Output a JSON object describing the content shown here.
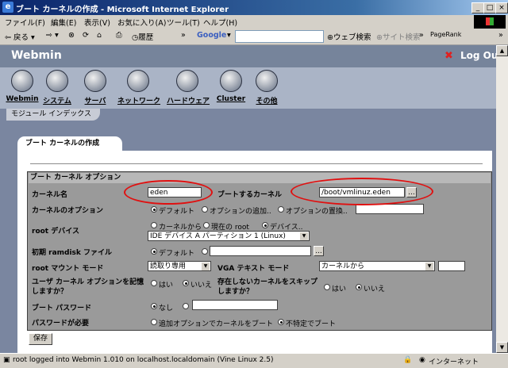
{
  "window": {
    "title": "ブート カーネルの作成 - Microsoft Internet Explorer"
  },
  "menu": [
    "ファイル(F)",
    "編集(E)",
    "表示(V)",
    "お気に入り(A)",
    "ツール(T)",
    "ヘルプ(H)"
  ],
  "toolbar": {
    "back": "戻る",
    "history": "履歴",
    "google": "Google",
    "web_search": "ウェブ検索",
    "site_search": "サイト検索",
    "pagerank": "PageRank"
  },
  "webmin": {
    "logo": "Webmin",
    "logout": "Log Out",
    "categories": [
      "Webmin",
      "システム",
      "サーバ",
      "ネットワーク",
      "ハードウェア",
      "Cluster",
      "その他"
    ],
    "module_index": "モジュール インデックス",
    "tab_title": "ブート カーネルの作成"
  },
  "form": {
    "section_title": "ブート カーネル オプション",
    "kernel_name_label": "カーネル名",
    "kernel_name_value": "eden",
    "boot_kernel_label": "ブートするカーネル",
    "boot_kernel_value": "/boot/vmlinuz.eden",
    "browse": "...",
    "kernel_options_label": "カーネルのオプション",
    "kernel_options": [
      "デフォルト",
      "オプションの追加..",
      "オプションの置換.."
    ],
    "root_device_label": "root デバイス",
    "root_device_options": [
      "カーネルから",
      "現在の root",
      "デバイス.."
    ],
    "root_device_select": "IDE デバイス A パーティション 1 (Linux)",
    "initrd_label": "初期 ramdisk ファイル",
    "initrd_default": "デフォルト",
    "root_mount_label": "root マウント モード",
    "root_mount_select": "読取り専用",
    "vga_label": "VGA テキスト モード",
    "vga_select": "カーネルから",
    "user_options_label": "ユーザ カーネル オプションを記憶しますか？",
    "skip_kernel_label": "存在しないカーネルをスキップしますか？",
    "yes": "はい",
    "no": "いいえ",
    "boot_password_label": "ブート パスワード",
    "none": "なし",
    "password_required_label": "パスワードが必要",
    "password_required_options": [
      "追加オプションでカーネルをブート",
      "不特定でブート"
    ],
    "save": "保存"
  },
  "status": {
    "text": "root logged into Webmin 1.010 on localhost.localdomain (Vine Linux 2.5)",
    "zone": "インターネット"
  },
  "colors": {
    "annotation": "#e01010",
    "titlebar": "#0a246a"
  }
}
